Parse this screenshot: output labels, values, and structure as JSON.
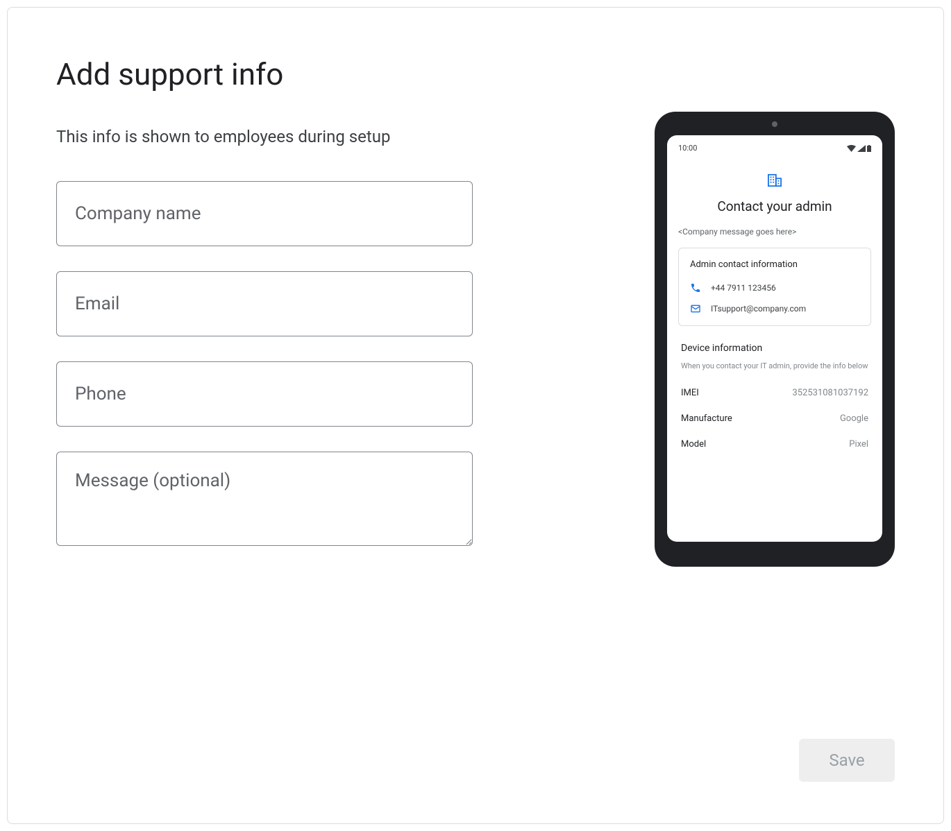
{
  "header": {
    "title": "Add support info",
    "subtitle": "This info is shown to employees during setup"
  },
  "form": {
    "company_placeholder": "Company name",
    "email_placeholder": "Email",
    "phone_placeholder": "Phone",
    "message_placeholder": "Message (optional)"
  },
  "preview": {
    "status_time": "10:00",
    "heading": "Contact your admin",
    "company_message": "<Company message goes here>",
    "card_title": "Admin contact information",
    "phone_number": "+44 7911 123456",
    "email_address": "ITsupport@company.com",
    "device_title": "Device information",
    "device_subtitle": "When you contact your IT admin, provide the info below",
    "imei_label": "IMEI",
    "imei_value": "352531081037192",
    "manufacture_label": "Manufacture",
    "manufacture_value": "Google",
    "model_label": "Model",
    "model_value": "Pixel"
  },
  "actions": {
    "save_label": "Save"
  }
}
